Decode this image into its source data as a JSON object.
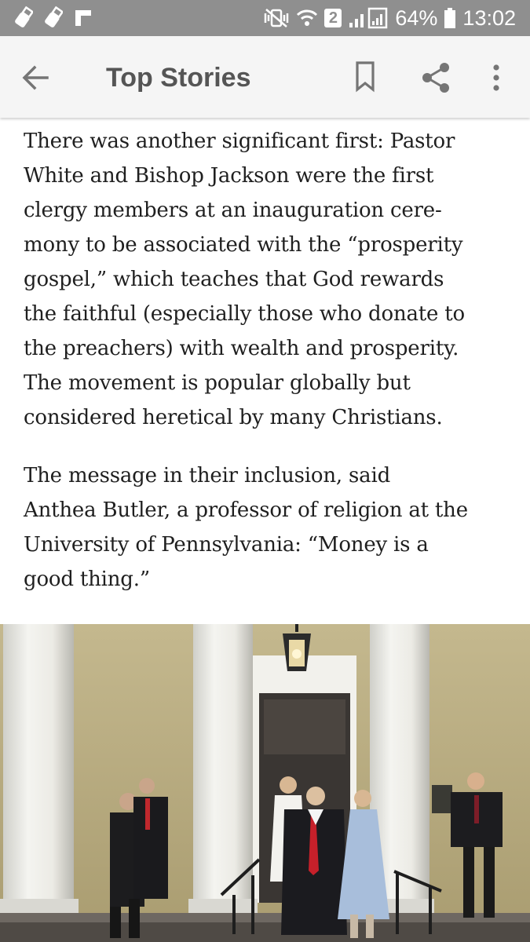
{
  "status_bar": {
    "battery_percent": "64%",
    "time": "13:02",
    "sim_badge": "2",
    "icons": [
      "usb-icon",
      "usb-icon",
      "flipboard-icon",
      "mute-vibrate-icon",
      "wifi-icon",
      "signal-icon",
      "battery-icon"
    ]
  },
  "app_bar": {
    "title": "Top Stories",
    "icons": [
      "back-arrow-icon",
      "bookmark-icon",
      "share-icon",
      "more-vert-icon"
    ]
  },
  "article": {
    "paragraph_1": "There was another significant first: Pastor\nWhite and Bishop Jackson were the first\nclergy members at an inauguration cere-\nmony to be associated with the “prosperity\ngospel,” which teaches that God rewards\nthe faithful (especially those who donate to\nthe preachers) with wealth and prosperity.\nThe movement is popular globally but\nconsidered heretical by many Christians.",
    "paragraph_2": "The message in their inclusion, said\nAnthea Butler, a professor of religion at the\nUniversity of Pennsylvania: “Money is a\ngood thing.”"
  },
  "colors": {
    "status_bar_bg": "#8f8f8f",
    "app_bar_bg": "#f5f5f5",
    "icon_gray": "#757575",
    "text": "#1f1f1f",
    "wall": "#b9ad83"
  }
}
